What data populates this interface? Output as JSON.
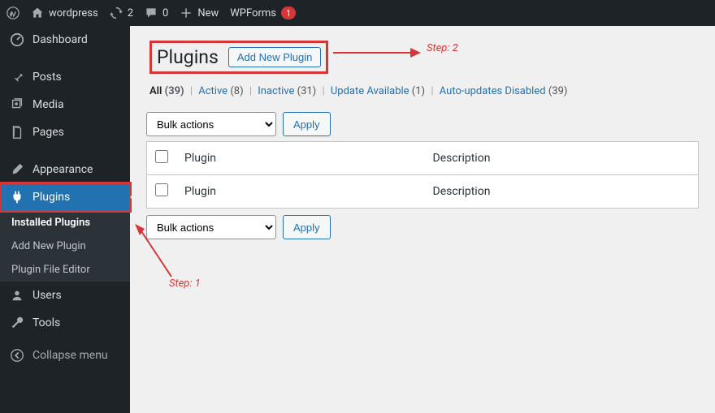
{
  "adminbar": {
    "site": "wordpress",
    "updates": "2",
    "comments": "0",
    "new": "New",
    "wpforms": "WPForms",
    "wpforms_badge": "1"
  },
  "sidebar": {
    "dashboard": "Dashboard",
    "posts": "Posts",
    "media": "Media",
    "pages": "Pages",
    "appearance": "Appearance",
    "plugins": "Plugins",
    "sub_installed": "Installed Plugins",
    "sub_addnew": "Add New Plugin",
    "sub_editor": "Plugin File Editor",
    "users": "Users",
    "tools": "Tools",
    "collapse": "Collapse menu"
  },
  "page": {
    "title": "Plugins",
    "add_button": "Add New Plugin",
    "filters": {
      "all_label": "All",
      "all_count": "(39)",
      "active_label": "Active",
      "active_count": "(8)",
      "inactive_label": "Inactive",
      "inactive_count": "(31)",
      "update_label": "Update Available",
      "update_count": "(1)",
      "auto_label": "Auto-updates Disabled",
      "auto_count": "(39)"
    },
    "bulk_placeholder": "Bulk actions",
    "apply": "Apply",
    "col_plugin": "Plugin",
    "col_desc": "Description"
  },
  "annotations": {
    "step1": "Step: 1",
    "step2": "Step: 2"
  }
}
